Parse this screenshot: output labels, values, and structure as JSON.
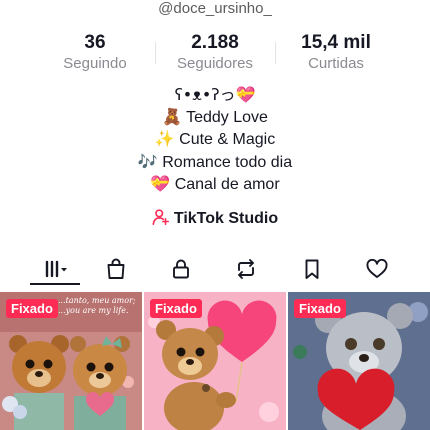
{
  "profile": {
    "username": "@doce_ursinho_"
  },
  "stats": [
    {
      "value": "36",
      "label": "Seguindo"
    },
    {
      "value": "2.188",
      "label": "Seguidores"
    },
    {
      "value": "15,4 mil",
      "label": "Curtidas"
    }
  ],
  "bio": {
    "line1": "ʕ•ᴥ•ʔっ💝",
    "line2_emoji": "🧸",
    "line2_text": "Teddy Love",
    "line3_emoji": "✨",
    "line3_text": "Cute & Magic",
    "line4_emoji": "🎶",
    "line4_text": "Romance todo dia",
    "line5_emoji": "💝",
    "line5_text": "Canal de amor"
  },
  "studio": {
    "label": "TikTok Studio",
    "icon": "person-plus-icon"
  },
  "tabs": [
    {
      "icon": "videos-grid-icon",
      "active": true
    },
    {
      "icon": "shopping-bag-icon"
    },
    {
      "icon": "lock-icon"
    },
    {
      "icon": "repost-icon"
    },
    {
      "icon": "bookmark-icon"
    },
    {
      "icon": "heart-icon"
    }
  ],
  "videos": [
    {
      "badge": "Fixado",
      "caption": "...tanto, meu amor; ...you are my life."
    },
    {
      "badge": "Fixado"
    },
    {
      "badge": "Fixado"
    }
  ],
  "colors": {
    "accent": "#fe2c55",
    "text": "#161823",
    "muted": "#8a8b91"
  }
}
